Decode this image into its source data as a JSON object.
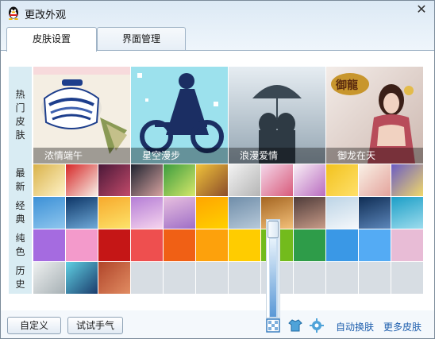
{
  "window": {
    "title": "更改外观",
    "close_icon": "close-icon"
  },
  "tabs": [
    {
      "label": "皮肤设置",
      "active": true
    },
    {
      "label": "界面管理",
      "active": false
    }
  ],
  "sections": {
    "hot": {
      "label": "热门皮肤"
    },
    "newest": {
      "label": "最新"
    },
    "classic": {
      "label": "经典"
    },
    "solid": {
      "label": "纯色"
    },
    "history": {
      "label": "历史"
    }
  },
  "hot_skins": [
    {
      "name": "浓情端午",
      "colors": [
        "#f3ecdf",
        "#1d3e8c"
      ]
    },
    {
      "name": "星空漫步",
      "colors": [
        "#8fdcea",
        "#1b2e63"
      ]
    },
    {
      "name": "浪漫爱情",
      "colors": [
        "#c7d3dc",
        "#2e3a44"
      ]
    },
    {
      "name": "御龙在天",
      "colors": [
        "#e6d6cf",
        "#6a3020"
      ]
    }
  ],
  "newest_skins": [
    {
      "colors": [
        "#d9b24a",
        "#fff3c9"
      ]
    },
    {
      "colors": [
        "#d62727",
        "#f7f0e8"
      ]
    },
    {
      "colors": [
        "#4a1838",
        "#c24a6a"
      ]
    },
    {
      "colors": [
        "#1e2330",
        "#d7a3a0"
      ]
    },
    {
      "colors": [
        "#3a9c3e",
        "#d8e86a"
      ]
    },
    {
      "colors": [
        "#f0c33a",
        "#8b4c2a"
      ]
    },
    {
      "colors": [
        "#f3f3f3",
        "#b5b5b5"
      ]
    },
    {
      "colors": [
        "#f4d7ea",
        "#d85a7a"
      ]
    },
    {
      "colors": [
        "#f9f0f6",
        "#b96cc0"
      ]
    },
    {
      "colors": [
        "#f2c21e",
        "#ffe06a"
      ]
    },
    {
      "colors": [
        "#f9f1e6",
        "#e4a39c"
      ]
    },
    {
      "colors": [
        "#6b5cc3",
        "#f1d96a"
      ]
    }
  ],
  "classic_skins": [
    {
      "colors": [
        "#3c90d6",
        "#8ec6ee"
      ]
    },
    {
      "colors": [
        "#0d3566",
        "#6faad9"
      ]
    },
    {
      "colors": [
        "#f7a92c",
        "#fde36a"
      ]
    },
    {
      "colors": [
        "#b47dd6",
        "#f6d4ee"
      ]
    },
    {
      "colors": [
        "#e8c0df",
        "#9f6ec7"
      ]
    },
    {
      "colors": [
        "#ffa500",
        "#ffd000"
      ]
    },
    {
      "colors": [
        "#6f8da9",
        "#b7c9d9"
      ]
    },
    {
      "colors": [
        "#a46521",
        "#f3c07a"
      ]
    },
    {
      "colors": [
        "#4e3b39",
        "#c89b88"
      ]
    },
    {
      "colors": [
        "#bcd4e6",
        "#f5f8fb"
      ]
    },
    {
      "colors": [
        "#0f2d54",
        "#5c86ba"
      ]
    },
    {
      "colors": [
        "#1b9ec7",
        "#9ddced"
      ]
    }
  ],
  "solid_colors": [
    "#a56be0",
    "#f39acb",
    "#c51616",
    "#ee4f4f",
    "#f06015",
    "#fda10c",
    "#ffcc00",
    "#73bb1c",
    "#2e9c49",
    "#3a98e6",
    "#54abf4",
    "#e8bcd6"
  ],
  "history_skins": [
    {
      "colors": [
        "#eef0f0",
        "#a7b1b5"
      ]
    },
    {
      "colors": [
        "#5fd0e3",
        "#1b3c6c"
      ]
    },
    {
      "colors": [
        "#b0452a",
        "#e18c62"
      ]
    }
  ],
  "bottom": {
    "customize_label": "自定义",
    "try_luck_label": "试试手气",
    "auto_switch_label": "自动换肤",
    "more_skins_label": "更多皮肤"
  }
}
